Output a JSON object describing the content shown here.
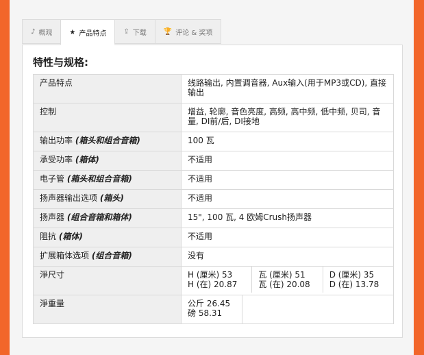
{
  "tabs": [
    {
      "icon": "♪",
      "label": "概观"
    },
    {
      "icon": "★",
      "label": "产品特点"
    },
    {
      "icon": "⇪",
      "label": "下载"
    },
    {
      "icon": "🏆",
      "label": "评论 & 奖项"
    }
  ],
  "heading": "特性与规格:",
  "rows": [
    {
      "label": "产品特点",
      "note": "",
      "value": "线路输出, 内置调音器, Aux输入(用于MP3或CD), 直接输出"
    },
    {
      "label": "控制",
      "note": "",
      "value": "增益, 轮廓, 音色亮度, 高频, 高中频, 低中频, 贝司, 音量, DI前/后, DI接地"
    },
    {
      "label": "输出功率",
      "note": "(箱头和组合音箱)",
      "value": "100 瓦"
    },
    {
      "label": "承受功率",
      "note": "(箱体)",
      "value": "不适用"
    },
    {
      "label": "电子管",
      "note": "(箱头和组合音箱)",
      "value": "不适用"
    },
    {
      "label": "扬声器输出选项",
      "note": "(箱头)",
      "value": "不适用"
    },
    {
      "label": "扬声器",
      "note": "(组合音箱和箱体)",
      "value": "15\", 100 瓦, 4 欧姆Crush扬声器"
    },
    {
      "label": "阻抗",
      "note": "(箱体)",
      "value": "不适用"
    },
    {
      "label": "扩展箱体选项",
      "note": "(组合音箱)",
      "value": "没有"
    }
  ],
  "dimensions": {
    "label": "淨尺寸",
    "h_cm": "H (厘米) 53",
    "h_in": "H (在) 20.87",
    "w_cm": "瓦 (厘米) 51",
    "w_in": "瓦 (在) 20.08",
    "d_cm": "D (厘米) 35",
    "d_in": "D (在) 13.78"
  },
  "weight": {
    "label": "淨重量",
    "kg": "公斤 26.45",
    "lb": "磅 58.31"
  }
}
